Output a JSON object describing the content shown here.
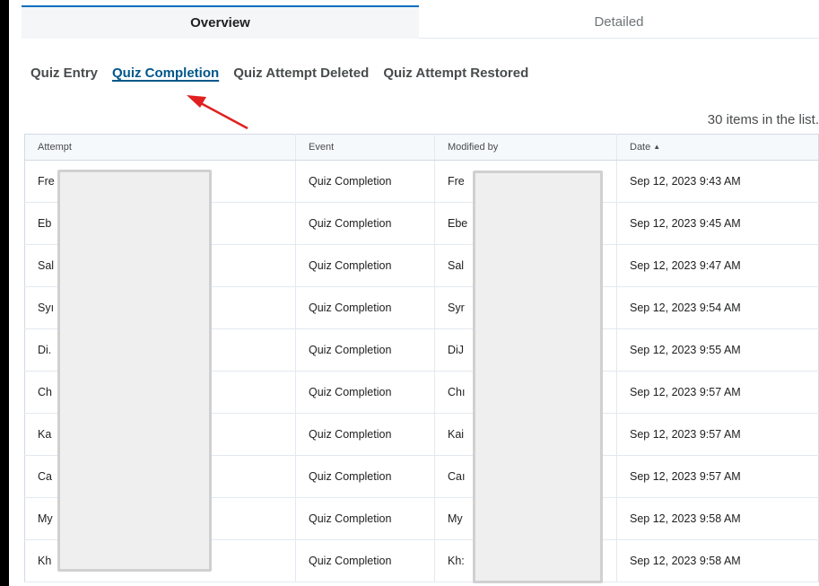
{
  "tabs": {
    "overview": "Overview",
    "detailed": "Detailed"
  },
  "subtabs": [
    "Quiz Entry",
    "Quiz Completion",
    "Quiz Attempt Deleted",
    "Quiz Attempt Restored"
  ],
  "list_count": "30 items in the list.",
  "table": {
    "headers": [
      "Attempt",
      "Event",
      "Modified by",
      "Date"
    ],
    "rows": [
      {
        "attempt": "Fre",
        "event": "Quiz Completion",
        "modified_by": "Fre",
        "date": "Sep 12, 2023 9:43 AM"
      },
      {
        "attempt": "Eb",
        "event": "Quiz Completion",
        "modified_by": "Ebe",
        "date": "Sep 12, 2023 9:45 AM"
      },
      {
        "attempt": "Sal",
        "event": "Quiz Completion",
        "modified_by": "Sal",
        "date": "Sep 12, 2023 9:47 AM"
      },
      {
        "attempt": "Syı",
        "event": "Quiz Completion",
        "modified_by": "Syr",
        "date": "Sep 12, 2023 9:54 AM"
      },
      {
        "attempt": "Di.",
        "event": "Quiz Completion",
        "modified_by": "DiJ",
        "date": "Sep 12, 2023 9:55 AM"
      },
      {
        "attempt": "Ch",
        "event": "Quiz Completion",
        "modified_by": "Chı",
        "date": "Sep 12, 2023 9:57 AM"
      },
      {
        "attempt": "Ka",
        "event": "Quiz Completion",
        "modified_by": "Kai",
        "date": "Sep 12, 2023 9:57 AM"
      },
      {
        "attempt": "Ca",
        "event": "Quiz Completion",
        "modified_by": "Caı",
        "date": "Sep 12, 2023 9:57 AM"
      },
      {
        "attempt": "My",
        "event": "Quiz Completion",
        "modified_by": "My",
        "date": "Sep 12, 2023 9:58 AM"
      },
      {
        "attempt": "Kh",
        "event": "Quiz Completion",
        "modified_by": "Kh:",
        "date": "Sep 12, 2023 9:58 AM"
      }
    ]
  },
  "colors": {
    "accent": "#006fbf",
    "annotation_arrow": "#e02020"
  }
}
